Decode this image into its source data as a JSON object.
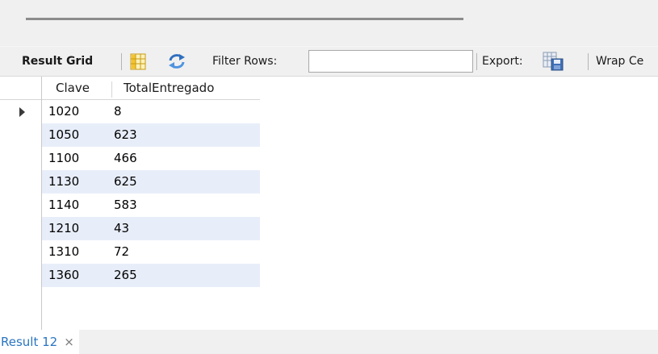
{
  "toolbar": {
    "result_grid_label": "Result Grid",
    "filter_rows_label": "Filter Rows:",
    "filter_rows_value": "",
    "export_label": "Export:",
    "wrap_label": "Wrap Ce"
  },
  "grid": {
    "columns": [
      "Clave",
      "TotalEntregado"
    ],
    "rows": [
      {
        "clave": "1020",
        "total": "8"
      },
      {
        "clave": "1050",
        "total": "623"
      },
      {
        "clave": "1100",
        "total": "466"
      },
      {
        "clave": "1130",
        "total": "625"
      },
      {
        "clave": "1140",
        "total": "583"
      },
      {
        "clave": "1210",
        "total": "43"
      },
      {
        "clave": "1310",
        "total": "72"
      },
      {
        "clave": "1360",
        "total": "265"
      }
    ]
  },
  "result_tab": {
    "label": "Result 12",
    "close_glyph": "×"
  },
  "colors": {
    "alt_row": "#e8eef9",
    "tab_text": "#2a75c0",
    "toolbar_bg": "#f0f0f0"
  },
  "icons": [
    "grid-view-icon",
    "refresh-icon",
    "export-icon",
    "row-pointer-icon",
    "close-icon"
  ]
}
